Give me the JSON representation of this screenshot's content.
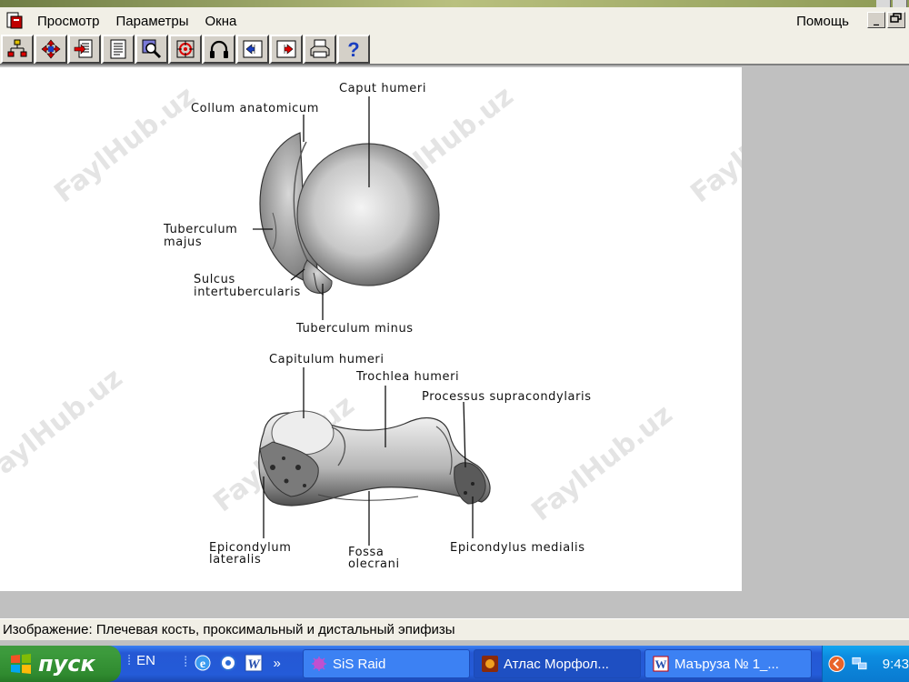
{
  "menubar": {
    "items": [
      "Просмотр",
      "Параметры",
      "Окна"
    ],
    "help": "Помощь",
    "minimize_glyph": "_",
    "restore_glyph": "ₘ"
  },
  "toolbar": {
    "buttons": [
      {
        "icon": "hierarchy-icon"
      },
      {
        "icon": "move-arrows-icon"
      },
      {
        "icon": "document-arrow-icon"
      },
      {
        "icon": "text-document-icon"
      },
      {
        "icon": "magnifier-icon"
      },
      {
        "icon": "target-icon"
      },
      {
        "icon": "headphones-icon"
      },
      {
        "icon": "arrow-left-frame-icon"
      },
      {
        "icon": "arrow-right-frame-icon"
      },
      {
        "icon": "printer-icon"
      },
      {
        "icon": "help-icon",
        "glyph": "?"
      }
    ]
  },
  "figure": {
    "labels": {
      "caput_humeri": "Caput humeri",
      "collum_anatomicum": "Collum anatomicum",
      "tuberculum_majus_1": "Tuberculum",
      "tuberculum_majus_2": "majus",
      "sulcus_1": "Sulcus",
      "sulcus_2": "intertubercularis",
      "tuberculum_minus": "Tuberculum minus",
      "capitulum_humeri": "Capitulum humeri",
      "trochlea_humeri": "Trochlea humeri",
      "processus_supracondylaris": "Processus supracondylaris",
      "epicondylum_1": "Epicondylum",
      "epicondylum_2": "lateralis",
      "fossa_1": "Fossa",
      "fossa_2": "olecrani",
      "epicondylus_medialis": "Epicondylus medialis"
    },
    "watermark": "FaylHub.uz"
  },
  "statusbar": {
    "text": "Изображение: Плечевая кость, проксимальный и дистальный эпифизы"
  },
  "taskbar": {
    "start_label": "пуск",
    "language": "EN",
    "chevron": "»",
    "tasks": [
      {
        "label": "SiS Raid",
        "icon": "sis-raid-icon"
      },
      {
        "label": "Атлас Морфол...",
        "icon": "atlas-app-icon"
      },
      {
        "label": "Маъруза № 1_...",
        "icon": "word-document-icon"
      }
    ],
    "clock": "9:43"
  }
}
